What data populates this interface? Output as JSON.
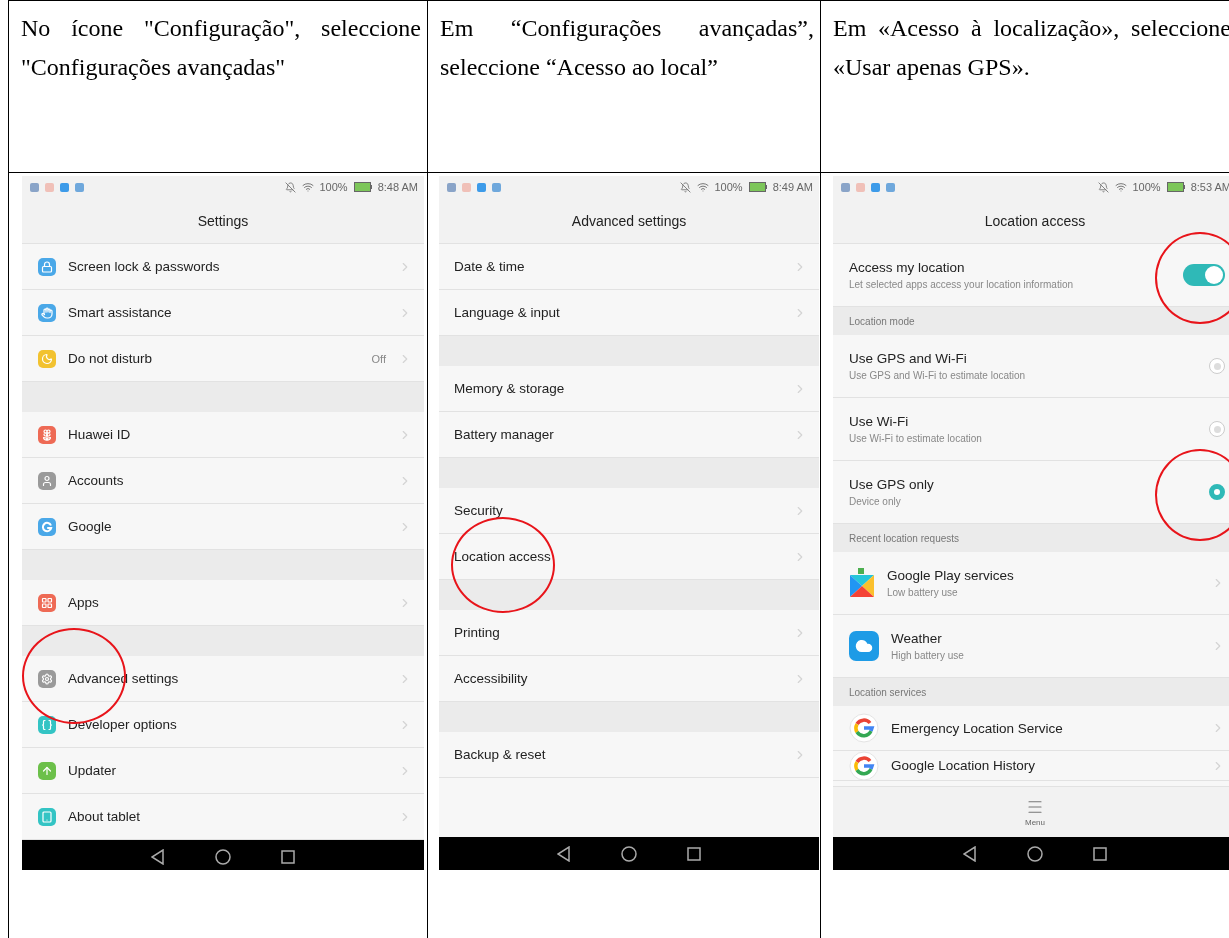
{
  "columns": [
    {
      "instruction": "No ícone \"Configuração\", seleccione \"Configurações avançadas\"",
      "screen": {
        "status": {
          "battery": "100%",
          "time": "8:48 AM"
        },
        "title": "Settings",
        "groups": [
          {
            "items": [
              {
                "kind": "nav",
                "color": "#4aa8e8",
                "label": "Screen lock & passwords",
                "circled": false
              },
              {
                "kind": "nav",
                "color": "#4aa8e8",
                "label": "Smart assistance",
                "circled": false
              },
              {
                "kind": "nav",
                "color": "#f2c230",
                "label": "Do not disturb",
                "value": "Off",
                "circled": false
              }
            ]
          },
          {
            "items": [
              {
                "kind": "nav",
                "color": "#ee6a55",
                "label": "Huawei ID",
                "circled": false
              },
              {
                "kind": "nav",
                "color": "#9a9a9a",
                "label": "Accounts",
                "circled": false
              },
              {
                "kind": "nav",
                "color": "#4aa8e8",
                "label": "Google",
                "circled": false
              }
            ]
          },
          {
            "items": [
              {
                "kind": "nav",
                "color": "#ee6a55",
                "label": "Apps",
                "circled": false
              }
            ]
          },
          {
            "items": [
              {
                "kind": "nav",
                "color": "#9a9a9a",
                "label": "Advanced settings",
                "circled": true
              },
              {
                "kind": "nav",
                "color": "#33c4c4",
                "label": "Developer options",
                "circled": false
              },
              {
                "kind": "nav",
                "color": "#6cc04a",
                "label": "Updater",
                "circled": false
              },
              {
                "kind": "nav",
                "color": "#33c4c4",
                "label": "About tablet",
                "circled": false
              }
            ]
          }
        ]
      }
    },
    {
      "instruction": "Em “Configurações avançadas”, seleccione “Acesso ao local”",
      "screen": {
        "status": {
          "battery": "100%",
          "time": "8:49 AM"
        },
        "title": "Advanced settings",
        "groups": [
          {
            "items": [
              {
                "kind": "nav",
                "label": "Date & time",
                "circled": false
              },
              {
                "kind": "nav",
                "label": "Language & input",
                "circled": false
              }
            ]
          },
          {
            "items": [
              {
                "kind": "nav",
                "label": "Memory & storage",
                "circled": false
              },
              {
                "kind": "nav",
                "label": "Battery manager",
                "circled": false
              }
            ]
          },
          {
            "items": [
              {
                "kind": "nav",
                "label": "Security",
                "circled": false
              },
              {
                "kind": "nav",
                "label": "Location access",
                "circled": true
              }
            ]
          },
          {
            "items": [
              {
                "kind": "nav",
                "label": "Printing",
                "circled": false
              },
              {
                "kind": "nav",
                "label": "Accessibility",
                "circled": false
              }
            ]
          },
          {
            "items": [
              {
                "kind": "nav",
                "label": "Backup & reset",
                "circled": false
              }
            ]
          }
        ]
      }
    },
    {
      "instruction": "Em «Acesso à localização», seleccione «Usar apenas GPS».",
      "screen": {
        "status": {
          "battery": "100%",
          "time": "8:53 AM"
        },
        "title": "Location access",
        "groups": [
          {
            "items": [
              {
                "kind": "toggle",
                "label": "Access my location",
                "sub": "Let selected apps access your location information",
                "on": true,
                "circled": true
              }
            ]
          },
          {
            "header": "Location mode",
            "items": [
              {
                "kind": "radio",
                "label": "Use GPS and Wi-Fi",
                "sub": "Use GPS and Wi-Fi to estimate location",
                "selected": false,
                "circled": false
              },
              {
                "kind": "radio",
                "label": "Use Wi-Fi",
                "sub": "Use Wi-Fi to estimate location",
                "selected": false,
                "circled": false
              },
              {
                "kind": "radio",
                "label": "Use GPS only",
                "sub": "Device only",
                "selected": true,
                "circled": true
              }
            ]
          },
          {
            "header": "Recent location requests",
            "items": [
              {
                "kind": "app",
                "label": "Google Play services",
                "sub": "Low battery use",
                "circled": false
              },
              {
                "kind": "app",
                "label": "Weather",
                "sub": "High battery use",
                "circled": false
              }
            ]
          },
          {
            "header": "Location services",
            "items": [
              {
                "kind": "app",
                "label": "Emergency Location Service",
                "circled": false
              },
              {
                "kind": "app",
                "label": "Google Location History",
                "circled": false
              }
            ]
          }
        ],
        "menu": "Menu"
      }
    }
  ]
}
